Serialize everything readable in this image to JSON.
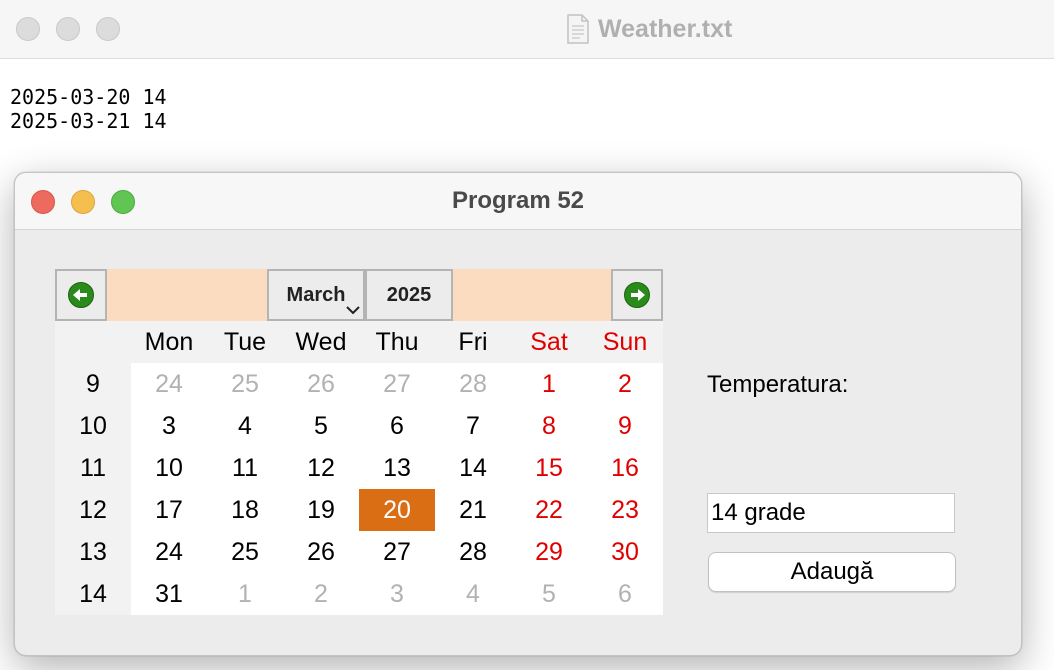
{
  "background_window": {
    "title": "Weather.txt",
    "lines": [
      "2025-03-20 14",
      "2025-03-21 14"
    ]
  },
  "dialog": {
    "title": "Program 52",
    "calendar": {
      "month": "March",
      "year": "2025",
      "day_headers": [
        "Mon",
        "Tue",
        "Wed",
        "Thu",
        "Fri",
        "Sat",
        "Sun"
      ],
      "week_numbers": [
        "9",
        "10",
        "11",
        "12",
        "13",
        "14"
      ],
      "weeks": [
        [
          {
            "d": "24",
            "m": "other"
          },
          {
            "d": "25",
            "m": "other"
          },
          {
            "d": "26",
            "m": "other"
          },
          {
            "d": "27",
            "m": "other"
          },
          {
            "d": "28",
            "m": "other"
          },
          {
            "d": "1",
            "m": "cur"
          },
          {
            "d": "2",
            "m": "cur"
          }
        ],
        [
          {
            "d": "3",
            "m": "cur"
          },
          {
            "d": "4",
            "m": "cur"
          },
          {
            "d": "5",
            "m": "cur"
          },
          {
            "d": "6",
            "m": "cur"
          },
          {
            "d": "7",
            "m": "cur"
          },
          {
            "d": "8",
            "m": "cur"
          },
          {
            "d": "9",
            "m": "cur"
          }
        ],
        [
          {
            "d": "10",
            "m": "cur"
          },
          {
            "d": "11",
            "m": "cur"
          },
          {
            "d": "12",
            "m": "cur"
          },
          {
            "d": "13",
            "m": "cur"
          },
          {
            "d": "14",
            "m": "cur"
          },
          {
            "d": "15",
            "m": "cur"
          },
          {
            "d": "16",
            "m": "cur"
          }
        ],
        [
          {
            "d": "17",
            "m": "cur"
          },
          {
            "d": "18",
            "m": "cur"
          },
          {
            "d": "19",
            "m": "cur"
          },
          {
            "d": "20",
            "m": "cur",
            "selected": true
          },
          {
            "d": "21",
            "m": "cur"
          },
          {
            "d": "22",
            "m": "cur"
          },
          {
            "d": "23",
            "m": "cur"
          }
        ],
        [
          {
            "d": "24",
            "m": "cur"
          },
          {
            "d": "25",
            "m": "cur"
          },
          {
            "d": "26",
            "m": "cur"
          },
          {
            "d": "27",
            "m": "cur"
          },
          {
            "d": "28",
            "m": "cur"
          },
          {
            "d": "29",
            "m": "cur"
          },
          {
            "d": "30",
            "m": "cur"
          }
        ],
        [
          {
            "d": "31",
            "m": "cur"
          },
          {
            "d": "1",
            "m": "other"
          },
          {
            "d": "2",
            "m": "other"
          },
          {
            "d": "3",
            "m": "other"
          },
          {
            "d": "4",
            "m": "other"
          },
          {
            "d": "5",
            "m": "other"
          },
          {
            "d": "6",
            "m": "other"
          }
        ]
      ],
      "selected_date": "20",
      "icons": {
        "prev": "arrow-left-icon",
        "next": "arrow-right-icon",
        "month_dropdown": "chevron-down-icon"
      }
    },
    "temperature_label": "Temperatura:",
    "temperature_value": "14 grade",
    "add_button": "Adaugă"
  },
  "colors": {
    "header_band": "#fcdcc0",
    "selected_day": "#d96e14",
    "weekend": "#e00000",
    "other_month": "#b2b2b2",
    "nav_arrow": "#2a8a1a"
  }
}
